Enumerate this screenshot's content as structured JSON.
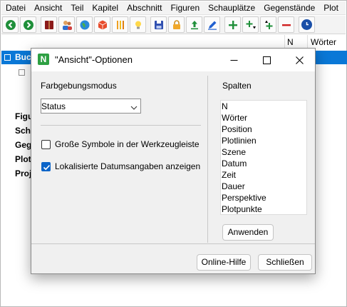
{
  "menubar": [
    "Datei",
    "Ansicht",
    "Teil",
    "Kapitel",
    "Abschnitt",
    "Figuren",
    "Schauplätze",
    "Gegenstände",
    "Plot"
  ],
  "columns": {
    "n": "N",
    "words": "Wörter"
  },
  "tree": {
    "selected_label": "Buc",
    "labels": [
      "Figu",
      "Sch",
      "Geg",
      "Plot",
      "Proj"
    ]
  },
  "dialog": {
    "title": "\"Ansicht\"-Optionen",
    "app_icon_letter": "N",
    "color_mode_label": "Farbgebungsmodus",
    "color_mode_value": "Status",
    "checkbox_large_icons": {
      "label": "Große Symbole in der Werkzeugleiste",
      "checked": false
    },
    "checkbox_localized_dates": {
      "label": "Lokalisierte Datumsangaben anzeigen",
      "checked": true
    },
    "columns_label": "Spalten",
    "columns_list": [
      "N",
      "Wörter",
      "Position",
      "Plotlinien",
      "Szene",
      "Datum",
      "Zeit",
      "Dauer",
      "Perspektive",
      "Plotpunkte"
    ],
    "apply_button": "Anwenden",
    "help_button": "Online-Hilfe",
    "close_button": "Schließen"
  },
  "colors": {
    "accent": "#0a78d7",
    "checkbox_checked": "#0a64c8",
    "app_icon": "#2ea043"
  }
}
